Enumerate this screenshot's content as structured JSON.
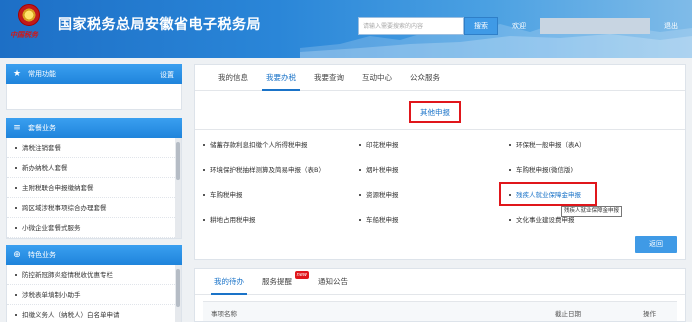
{
  "header": {
    "logo_slogan": "中国税务",
    "title": "国家税务总局安徽省电子税务局",
    "search_placeholder": "请输入需要搜索的内容",
    "search_button": "搜索",
    "welcome": "欢迎",
    "logout": "退出",
    "colors": {
      "brand": "#1d6fc6",
      "accent_red": "#e0161b"
    }
  },
  "sidebar": {
    "common": {
      "title": "常用功能",
      "settings": "设置",
      "icon": "star-icon"
    },
    "packages": {
      "title": "套餐业务",
      "icon": "layers-icon",
      "items": [
        "清税注销套餐",
        "新办纳税人套餐",
        "主附税联合申报缴纳套餐",
        "跨区域涉税事项综合办理套餐",
        "小微企业套餐式服务"
      ]
    },
    "special": {
      "title": "特色业务",
      "icon": "globe-icon",
      "items": [
        "防控新冠肺炎疫情税收优惠专栏",
        "涉税表单填制小助手",
        "扣缴义务人（纳税人）白名单申请"
      ]
    }
  },
  "main": {
    "tabs": [
      "我的信息",
      "我要办税",
      "我要查询",
      "互动中心",
      "公众服务"
    ],
    "active_tab": "我要办税",
    "section_title": "其他申报",
    "items": [
      [
        "储蓄存款利息扣缴个人所得税申报",
        "印花税申报",
        "环保税一般申报（表A）"
      ],
      [
        "环境保护税抽样测算及简易申报（表B）",
        "烟叶税申报",
        "车购税申报(微信版)"
      ],
      [
        "车购税申报",
        "资源税申报",
        "残疾人就业保障金申报"
      ],
      [
        "耕地占用税申报",
        "车船税申报",
        "文化事业建设费申报"
      ]
    ],
    "highlighted_item": "残疾人就业保障金申报",
    "tooltip": "残疾人就业保障金申报",
    "back_button": "返回"
  },
  "bottom": {
    "tabs": [
      "我的待办",
      "服务提醒",
      "通知公告"
    ],
    "active_tab": "我的待办",
    "new_badge": "new",
    "columns": [
      "事项名称",
      "截止日期",
      "操作"
    ]
  }
}
